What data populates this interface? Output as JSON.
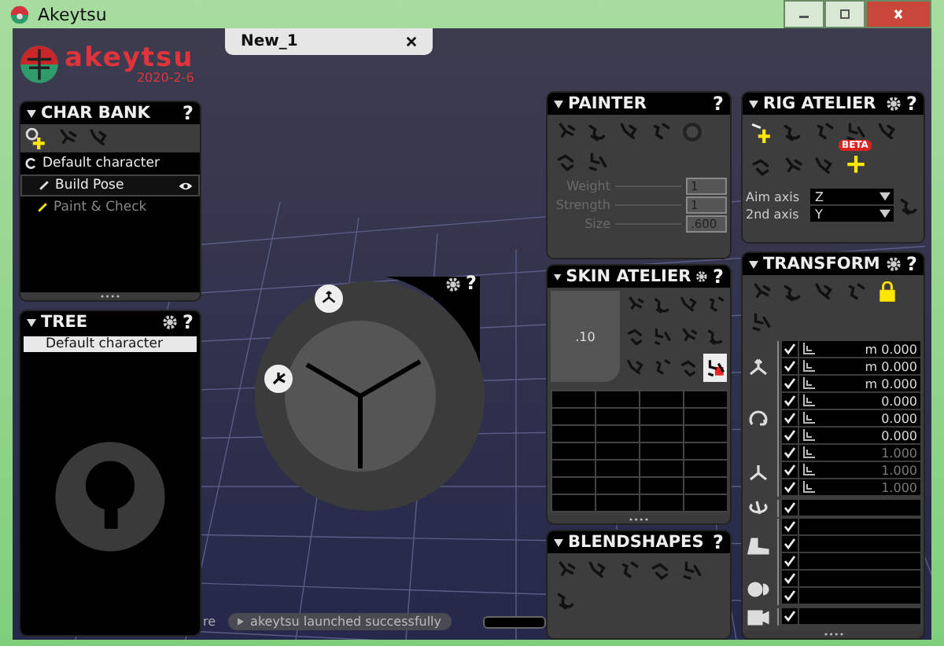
{
  "window": {
    "title": "Akeytsu"
  },
  "document_tab": {
    "label": "New_1"
  },
  "logo": {
    "name": "akeytsu",
    "version": "2020-2-6"
  },
  "char_bank": {
    "title": "CHAR BANK",
    "help": "?",
    "items": [
      {
        "label": "Default character",
        "kind": "character",
        "selected": false
      },
      {
        "label": "Build Pose",
        "kind": "mode",
        "selected": true
      },
      {
        "label": "Paint & Check",
        "kind": "mode",
        "selected": false
      }
    ]
  },
  "tree": {
    "title": "TREE",
    "help": "?",
    "items": [
      {
        "label": "Default character",
        "selected": true
      }
    ]
  },
  "painter": {
    "title": "PAINTER",
    "help": "?",
    "sliders": [
      {
        "label": "Weight",
        "value": "1"
      },
      {
        "label": "Strength",
        "value": "1"
      },
      {
        "label": "Size",
        "value": ".600"
      }
    ]
  },
  "skin_atelier": {
    "title": "SKIN ATELIER",
    "help": "?",
    "weight_preview": ".10",
    "tools": [
      {
        "selected": false
      },
      {
        "selected": false
      },
      {
        "selected": false
      },
      {
        "selected": false
      },
      {
        "selected": false
      },
      {
        "selected": false
      },
      {
        "selected": false
      },
      {
        "selected": false
      },
      {
        "selected": false
      },
      {
        "selected": false
      },
      {
        "selected": false
      },
      {
        "selected": true
      }
    ]
  },
  "blendshapes": {
    "title": "BLENDSHAPES",
    "help": "?"
  },
  "rig_atelier": {
    "title": "RIG ATELIER",
    "help": "?",
    "beta_badge": "BETA",
    "axes": [
      {
        "label": "Aim axis",
        "value": "Z"
      },
      {
        "label": "2nd axis",
        "value": "Y"
      }
    ]
  },
  "transform": {
    "title": "TRANSFORM",
    "help": "?",
    "groups": [
      {
        "kind": "translate",
        "rows": [
          {
            "checked": true,
            "value": "m 0.000",
            "disabled": false
          },
          {
            "checked": true,
            "value": "m 0.000",
            "disabled": false
          },
          {
            "checked": true,
            "value": "m 0.000",
            "disabled": false
          }
        ]
      },
      {
        "kind": "rotate",
        "rows": [
          {
            "checked": true,
            "value": "0.000",
            "disabled": false
          },
          {
            "checked": true,
            "value": "0.000",
            "disabled": false
          },
          {
            "checked": true,
            "value": "0.000",
            "disabled": false
          }
        ]
      },
      {
        "kind": "scale",
        "rows": [
          {
            "checked": true,
            "value": "1.000",
            "disabled": true
          },
          {
            "checked": true,
            "value": "1.000",
            "disabled": true
          },
          {
            "checked": true,
            "value": "1.000",
            "disabled": true
          }
        ]
      },
      {
        "kind": "spin",
        "rows": [
          {
            "checked": true
          }
        ]
      },
      {
        "kind": "foot",
        "rows": [
          {
            "checked": true
          },
          {
            "checked": true
          },
          {
            "checked": true
          }
        ]
      },
      {
        "kind": "balls",
        "rows": [
          {
            "checked": true
          },
          {
            "checked": true
          }
        ]
      },
      {
        "kind": "camera",
        "rows": [
          {
            "checked": true
          }
        ]
      }
    ]
  },
  "radial_menu": {
    "help": "?"
  },
  "viewport_hint": "re",
  "status_message": "akeytsu launched successfully"
}
